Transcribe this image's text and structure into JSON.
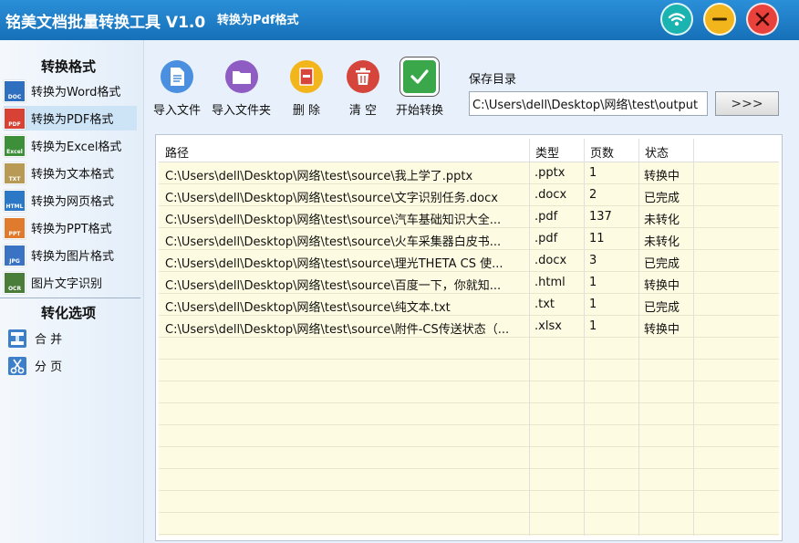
{
  "window": {
    "title": "铭美文档批量转换工具 V1.0",
    "subtitle": "转换为Pdf格式",
    "controls": {
      "wifi": "wifi-icon",
      "minimize": "minimize-icon",
      "close": "close-icon"
    }
  },
  "sidebar": {
    "formats_heading": "转换格式",
    "formats": [
      {
        "label": "转换为Word格式",
        "badge": "DOC",
        "color": "#2f6fc0"
      },
      {
        "label": "转换为PDF格式",
        "badge": "PDF",
        "color": "#d84234"
      },
      {
        "label": "转换为Excel格式",
        "badge": "Excel",
        "color": "#3e8f3a"
      },
      {
        "label": "转换为文本格式",
        "badge": "TXT",
        "color": "#b89a55"
      },
      {
        "label": "转换为网页格式",
        "badge": "HTML",
        "color": "#2b78c6"
      },
      {
        "label": "转换为PPT格式",
        "badge": "PPT",
        "color": "#e07a2d"
      },
      {
        "label": "转换为图片格式",
        "badge": "JPG",
        "color": "#3a72c4"
      },
      {
        "label": "图片文字识别",
        "badge": "OCR",
        "color": "#4b7d3a"
      }
    ],
    "active_index": 1,
    "options_heading": "转化选项",
    "options": [
      {
        "label": "合 并",
        "icon": "merge-icon"
      },
      {
        "label": "分 页",
        "icon": "split-icon"
      }
    ]
  },
  "toolbar": {
    "import_file": "导入文件",
    "import_folder": "导入文件夹",
    "delete": "删 除",
    "clear": "清 空",
    "start": "开始转换",
    "save_dir_label": "保存目录",
    "save_dir_value": "C:\\Users\\dell\\Desktop\\网络\\test\\output",
    "browse_label": ">>>"
  },
  "table": {
    "columns": [
      "路径",
      "类型",
      "页数",
      "状态"
    ],
    "rows": [
      [
        "C:\\Users\\dell\\Desktop\\网络\\test\\source\\我上学了.pptx",
        ".pptx",
        "1",
        "转换中"
      ],
      [
        "C:\\Users\\dell\\Desktop\\网络\\test\\source\\文字识别任务.docx",
        ".docx",
        "2",
        "已完成"
      ],
      [
        "C:\\Users\\dell\\Desktop\\网络\\test\\source\\汽车基础知识大全...",
        ".pdf",
        "137",
        "未转化"
      ],
      [
        "C:\\Users\\dell\\Desktop\\网络\\test\\source\\火车采集器白皮书...",
        ".pdf",
        "11",
        "未转化"
      ],
      [
        "C:\\Users\\dell\\Desktop\\网络\\test\\source\\理光THETA CS 使...",
        ".docx",
        "3",
        "已完成"
      ],
      [
        "C:\\Users\\dell\\Desktop\\网络\\test\\source\\百度一下，你就知...",
        ".html",
        "1",
        "转换中"
      ],
      [
        "C:\\Users\\dell\\Desktop\\网络\\test\\source\\纯文本.txt",
        ".txt",
        "1",
        "已完成"
      ],
      [
        "C:\\Users\\dell\\Desktop\\网络\\test\\source\\附件-CS传送状态（...",
        ".xlsx",
        "1",
        "转换中"
      ]
    ]
  },
  "colors": {
    "titlebar": "#1e80c8",
    "table_bg": "#fdfbe1",
    "import_file_icon": "#4a8fe0",
    "import_folder_icon": "#8f5cc4",
    "delete_icon": "#f2b51c",
    "clear_icon": "#d6453b",
    "start_icon": "#3aa84a"
  }
}
